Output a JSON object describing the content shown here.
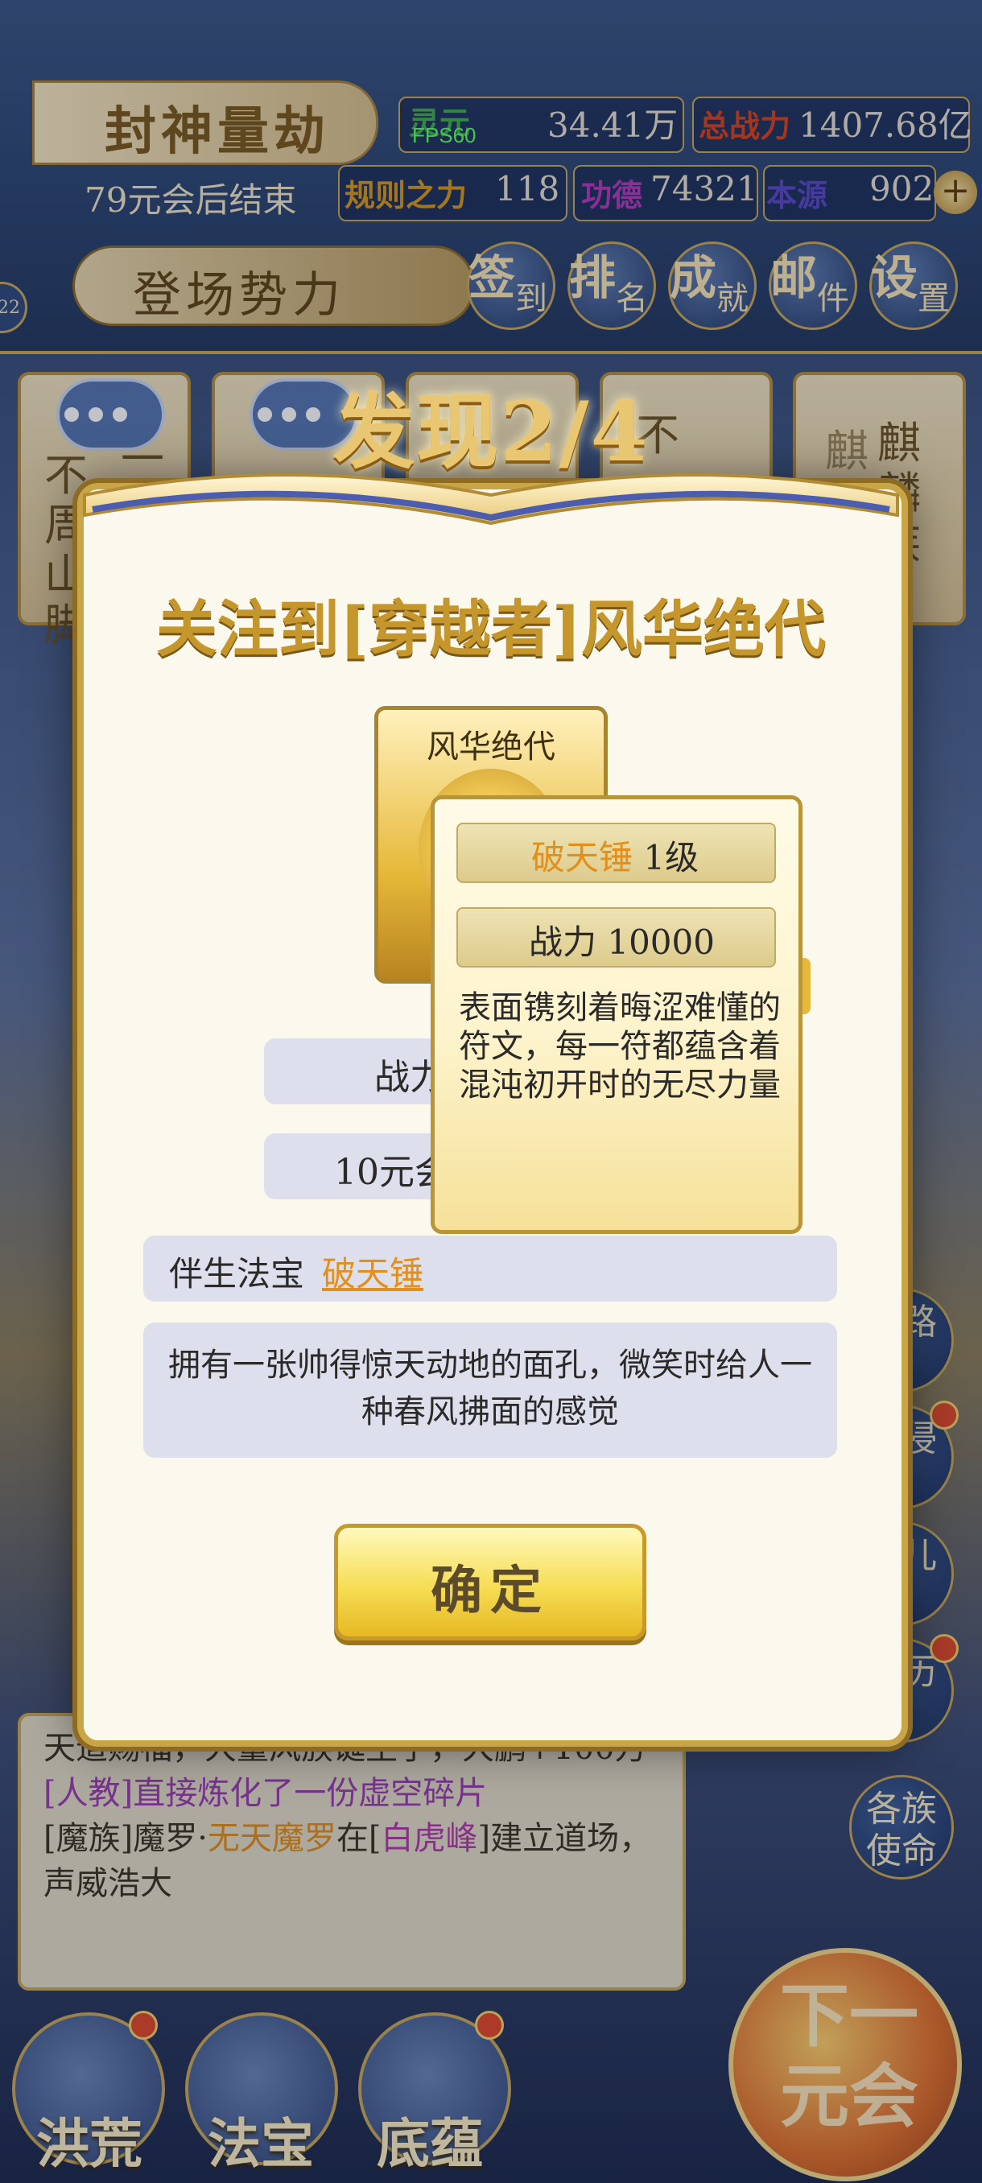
{
  "topbar": {
    "title": "封神量劫",
    "end_hint": "79元会后结束",
    "fps": "FPS60",
    "faction_label": "登场势力",
    "side_badge": "22",
    "stats": [
      {
        "label": "灵元",
        "value": "34.41万",
        "color": "#3fb04a"
      },
      {
        "label": "总战力",
        "value": "1407.68亿",
        "color": "#d8431d"
      },
      {
        "label": "规则之力",
        "value": "118",
        "color": "#d79a1e"
      },
      {
        "label": "功德",
        "value": "74321",
        "color": "#b23bbd"
      },
      {
        "label": "本源",
        "value": "902",
        "color": "#5a49c8"
      }
    ],
    "plus": "+",
    "menu": [
      {
        "c1": "签",
        "c2": "到"
      },
      {
        "c1": "排",
        "c2": "名"
      },
      {
        "c1": "成",
        "c2": "就"
      },
      {
        "c1": "邮",
        "c2": "件"
      },
      {
        "c1": "设",
        "c2": "置"
      }
    ]
  },
  "bg_cards": [
    {
      "text": "不周山脚",
      "lead": "一万"
    },
    {
      "text": "",
      "lead": ""
    },
    {
      "text": "",
      "lead": ""
    },
    {
      "text": "不",
      "lead": ""
    },
    {
      "text": "麒麟族",
      "lead": "麒"
    }
  ],
  "right_buttons": [
    "道路",
    "域侵",
    "道儿",
    "身历",
    "各族使命"
  ],
  "log": {
    "line1": "天道赐福，大量风族诞生了，大鹏+100万",
    "line2": "[人教]直接炼化了一份虚空碎片",
    "line3_a": "[魔族]魔罗·",
    "line3_b": "无天魔罗",
    "line3_c": "在[",
    "line3_d": "白虎峰",
    "line3_e": "]建立道场，声威浩大"
  },
  "bottom_nav": [
    "洪荒",
    "法宝",
    "底蕴"
  ],
  "next_button": "下一元会",
  "modal": {
    "header": "发现2/4",
    "title": "关注到[穿越者]风华绝代",
    "portrait_name": "风华绝代",
    "row1": "战力",
    "row2": "10元会",
    "companion_label": "伴生法宝",
    "companion_value": "破天锤",
    "description": "拥有一张帅得惊天动地的面孔，微笑时给人一种春风拂面的感觉",
    "confirm": "确定"
  },
  "tooltip": {
    "name": "破天锤",
    "level": "1级",
    "power": "战力 10000",
    "description": "表面镌刻着晦涩难懂的符文，每一符都蕴含着混沌初开时的无尽力量"
  }
}
